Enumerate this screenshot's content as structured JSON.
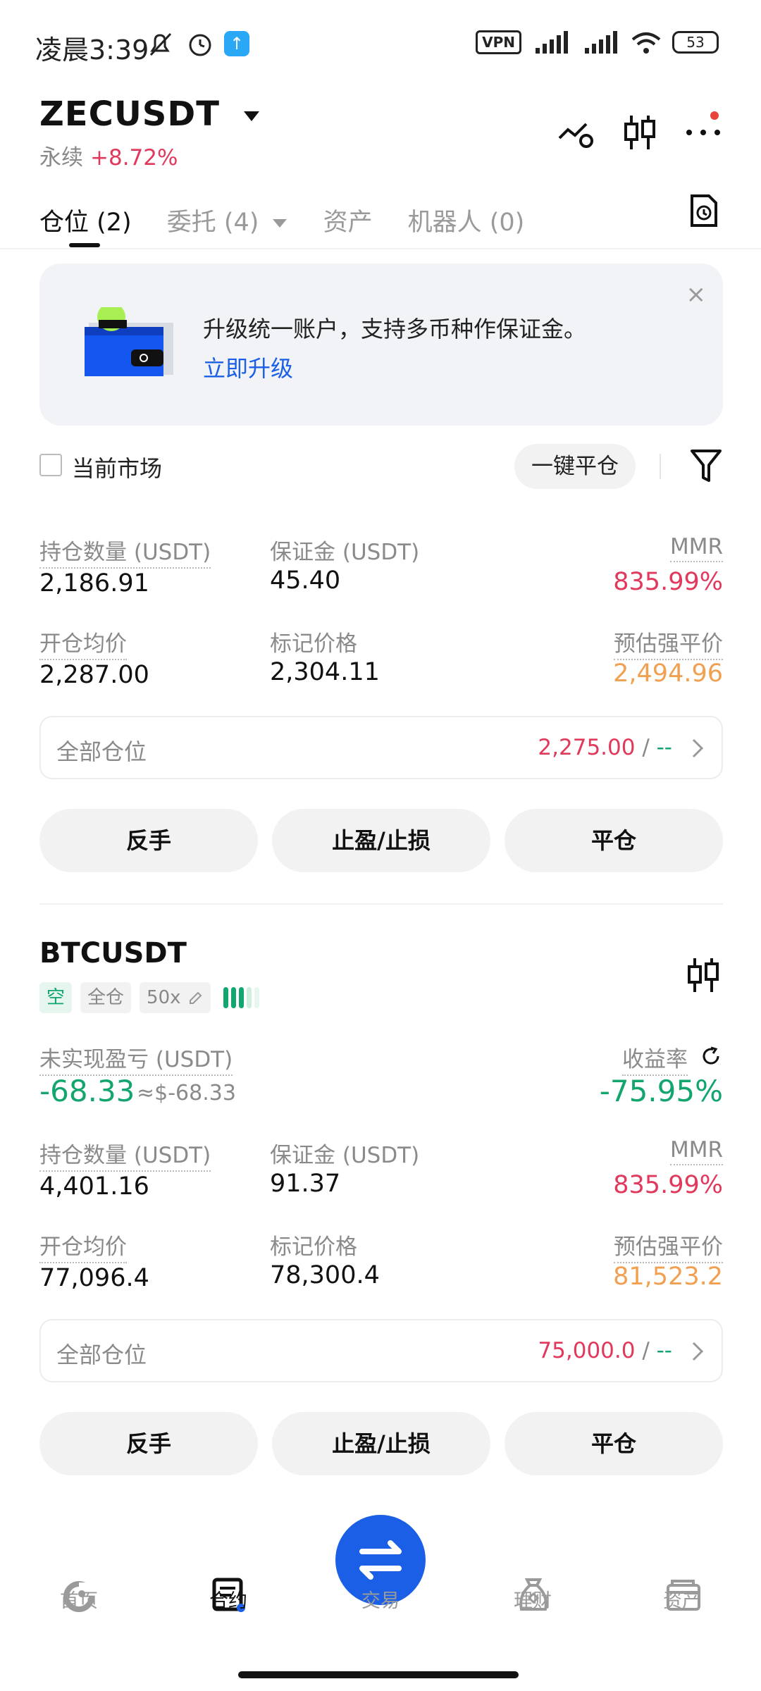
{
  "status_bar": {
    "time": "凌晨3:39",
    "vpn": "VPN",
    "battery": "53"
  },
  "header": {
    "symbol": "ZECUSDT",
    "type": "永续",
    "change": "+8.72%"
  },
  "tabs": [
    {
      "label": "仓位 (2)",
      "active": true
    },
    {
      "label": "委托 (4)",
      "active": false
    },
    {
      "label": "资产",
      "active": false
    },
    {
      "label": "机器人 (0)",
      "active": false
    }
  ],
  "banner": {
    "text": "升级统一账户，支持多币种作保证金。",
    "link": "立即升级",
    "close": "×"
  },
  "filter_row": {
    "checkbox_label": "当前市场",
    "close_all": "一键平仓"
  },
  "labels": {
    "position_qty": "持仓数量 (USDT)",
    "margin": "保证金 (USDT)",
    "mmr": "MMR",
    "entry_price": "开仓均价",
    "mark_price": "标记价格",
    "liq_price": "预估强平价",
    "all_positions": "全部仓位",
    "unrealized_pnl": "未实现盈亏 (USDT)",
    "roe": "收益率",
    "reverse": "反手",
    "tpsl": "止盈/止损",
    "close": "平仓"
  },
  "position1": {
    "qty": "2,186.91",
    "margin": "45.40",
    "mmr": "835.99%",
    "entry": "2,287.00",
    "mark": "2,304.11",
    "liq": "2,494.96",
    "all_pos_value": "2,275.00",
    "all_pos_sep": " / ",
    "all_pos_tail": "--"
  },
  "position2": {
    "symbol": "BTCUSDT",
    "side": "空",
    "mode": "全仓",
    "leverage": "50x",
    "pnl": "-68.33",
    "pnl_approx": "≈$-68.33",
    "roe": "-75.95%",
    "qty": "4,401.16",
    "margin": "91.37",
    "mmr": "835.99%",
    "entry": "77,096.4",
    "mark": "78,300.4",
    "liq": "81,523.2",
    "all_pos_value": "75,000.0",
    "all_pos_sep": " / ",
    "all_pos_tail": "--"
  },
  "nav": {
    "home": "首页",
    "contract": "合约",
    "trade": "交易",
    "finance": "理财",
    "assets": "资产"
  }
}
